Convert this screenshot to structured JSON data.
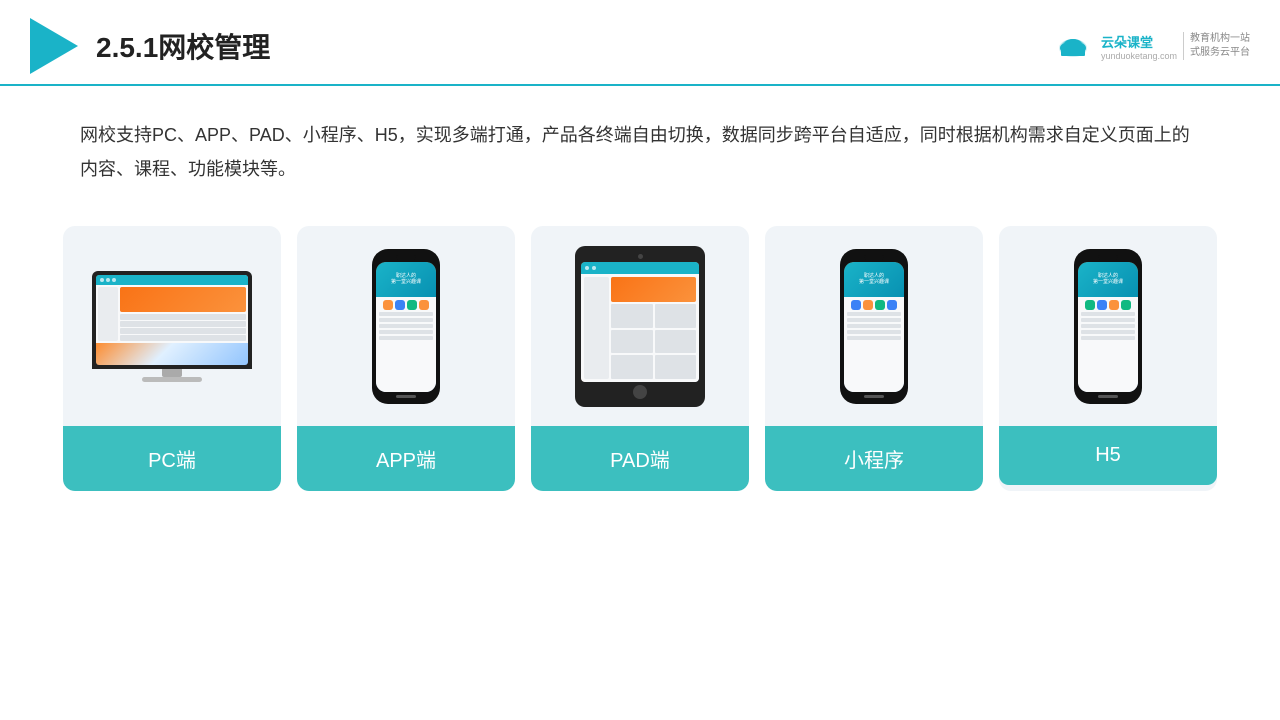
{
  "header": {
    "title": "2.5.1网校管理",
    "brand": {
      "name": "云朵课堂",
      "url": "yunduoketang.com",
      "slogan": "教育机构一站\n式服务云平台"
    }
  },
  "description": {
    "text": "网校支持PC、APP、PAD、小程序、H5，实现多端打通，产品各终端自由切换，数据同步跨平台自适应，同时根据机构需求自定义页面上的内容、课程、功能模块等。"
  },
  "cards": [
    {
      "id": "pc",
      "label": "PC端"
    },
    {
      "id": "app",
      "label": "APP端"
    },
    {
      "id": "pad",
      "label": "PAD端"
    },
    {
      "id": "mini",
      "label": "小程序"
    },
    {
      "id": "h5",
      "label": "H5"
    }
  ]
}
